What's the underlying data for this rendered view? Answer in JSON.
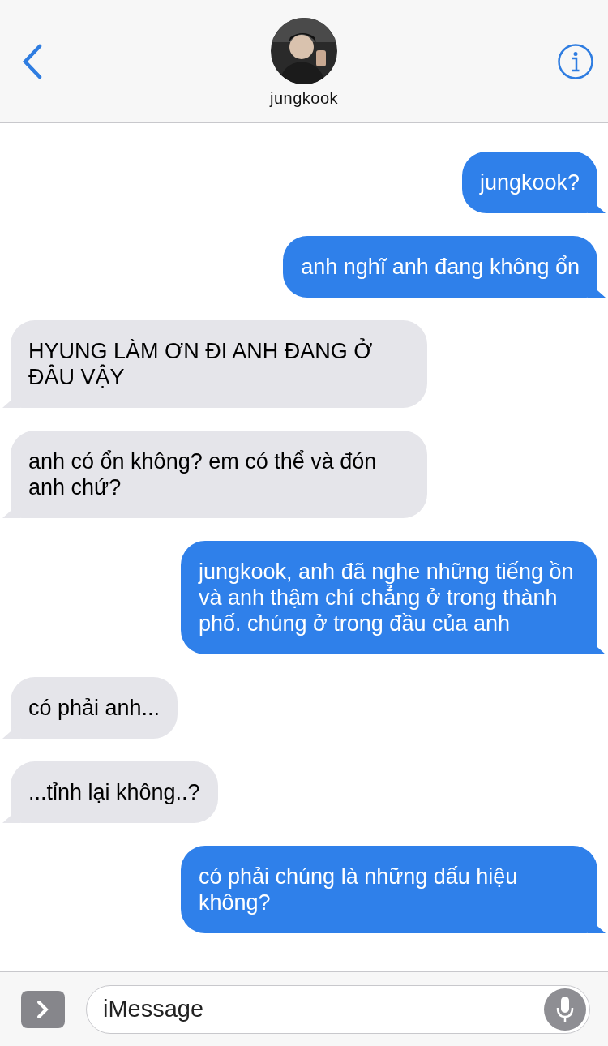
{
  "header": {
    "contact_name": "jungkook"
  },
  "messages": [
    {
      "kind": "sent",
      "text": "jungkook?"
    },
    {
      "kind": "sent",
      "text": "anh nghĩ anh đang không ổn"
    },
    {
      "kind": "received",
      "text": "HYUNG LÀM ƠN ĐI ANH ĐANG Ở ĐÂU VẬY"
    },
    {
      "kind": "received",
      "text": "anh có ổn không? em có thể và đón anh chứ?"
    },
    {
      "kind": "sent",
      "text": "jungkook, anh đã nghe những tiếng ồn và anh thậm chí chẳng ở trong thành phố. chúng ở trong đầu của anh"
    },
    {
      "kind": "received",
      "text": "có phải anh..."
    },
    {
      "kind": "received",
      "text": "...tỉnh lại không..?"
    },
    {
      "kind": "sent",
      "text": "có phải chúng là những dấu hiệu không?"
    }
  ],
  "composer": {
    "placeholder": "iMessage"
  }
}
